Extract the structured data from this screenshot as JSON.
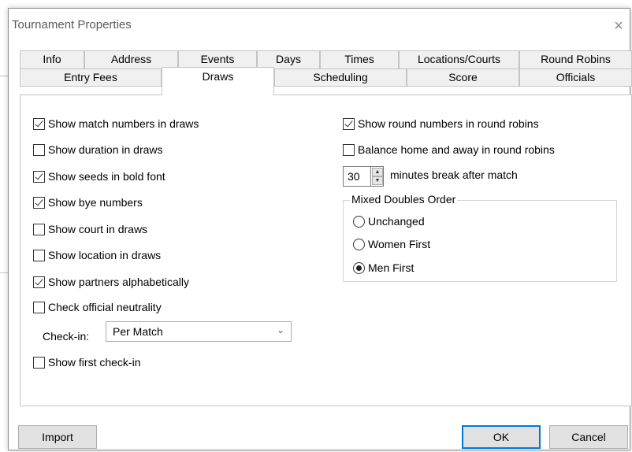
{
  "window": {
    "title": "Tournament Properties",
    "close_icon": "×"
  },
  "tabs": {
    "row1": [
      "Info",
      "Address",
      "Events",
      "Days",
      "Times",
      "Locations/Courts",
      "Round Robins"
    ],
    "row2": [
      "Entry Fees",
      "Draws",
      "Scheduling",
      "Score",
      "Officials"
    ],
    "active": "Draws"
  },
  "draws": {
    "left": [
      {
        "label": "Show match numbers in draws",
        "checked": true
      },
      {
        "label": "Show duration in draws",
        "checked": false
      },
      {
        "label": "Show seeds in bold font",
        "checked": true
      },
      {
        "label": "Show bye numbers",
        "checked": true
      },
      {
        "label": "Show court in draws",
        "checked": false
      },
      {
        "label": "Show location in draws",
        "checked": false
      },
      {
        "label": "Show partners alphabetically",
        "checked": true
      },
      {
        "label": "Check official neutrality",
        "checked": false
      }
    ],
    "checkin": {
      "label": "Check-in:",
      "value": "Per Match"
    },
    "first_checkin": {
      "label": "Show first check-in",
      "checked": false
    },
    "right": [
      {
        "label": "Show round numbers in round robins",
        "checked": true
      },
      {
        "label": "Balance home and away in round robins",
        "checked": false
      }
    ],
    "break": {
      "value": "30",
      "label": "minutes break after match"
    },
    "mixed_doubles": {
      "title": "Mixed Doubles Order",
      "options": [
        "Unchanged",
        "Women First",
        "Men First"
      ],
      "selected": "Men First"
    }
  },
  "buttons": {
    "import": "Import",
    "ok": "OK",
    "cancel": "Cancel"
  }
}
